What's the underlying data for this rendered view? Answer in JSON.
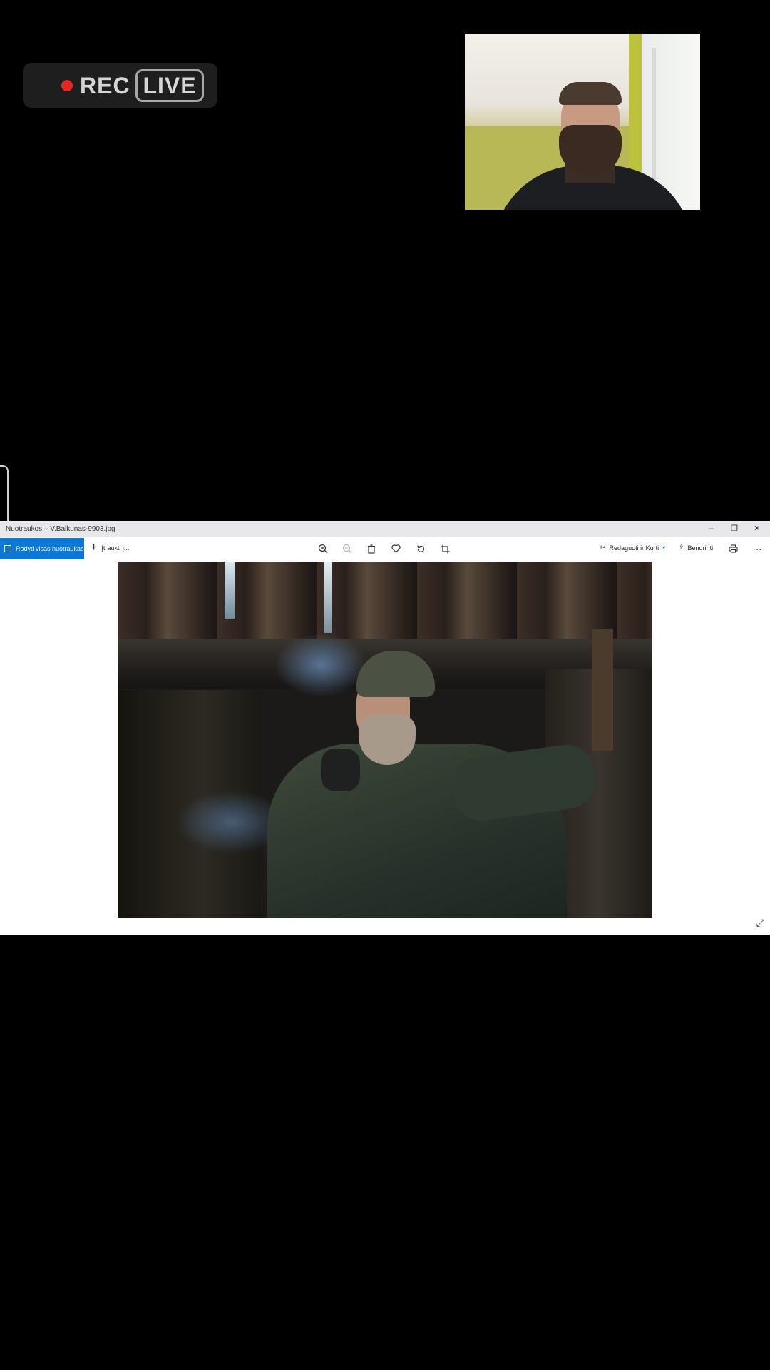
{
  "stream_overlay": {
    "rec_label": "REC",
    "live_label": "LIVE",
    "rec_color": "#e5281f"
  },
  "webcam": {
    "icon": "webcam-feed"
  },
  "photos_app": {
    "window_title": "Nuotraukos – V.Balkunas-9903.jpg",
    "window_controls": {
      "minimize": "–",
      "maximize": "❐",
      "close": "✕"
    },
    "toolbar": {
      "show_all_label": "Rodyti visas nuotraukas",
      "add_label": "Įtraukti į...",
      "zoom_in_icon": "zoom-in-icon",
      "zoom_out_icon": "zoom-out-icon",
      "delete_icon": "trash-icon",
      "favorite_icon": "heart-icon",
      "rotate_icon": "rotate-icon",
      "crop_icon": "crop-icon",
      "edit_label": "Redaguoti ir Kurti",
      "share_label": "Bendrinti",
      "print_icon": "print-icon",
      "more_label": "···"
    },
    "accent_color": "#0a78d4"
  }
}
